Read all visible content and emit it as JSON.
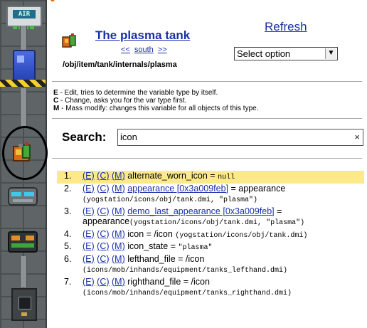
{
  "header": {
    "title": "The plasma tank",
    "nav_prev": "<<",
    "nav_location": "south",
    "nav_next": ">>",
    "type_path": "/obj/item/tank/internals/plasma",
    "refresh_label": "Refresh",
    "select_value": "Select option"
  },
  "sidebar": {
    "air_alarm_label": "AIR"
  },
  "help": [
    {
      "key": "E",
      "text": " - Edit, tries to determine the variable type by itself."
    },
    {
      "key": "C",
      "text": " - Change, asks you for the var type first."
    },
    {
      "key": "M",
      "text": " - Mass modify: changes this variable for all objects of this type."
    }
  ],
  "search": {
    "label": "Search:",
    "value": "icon",
    "clear_glyph": "×"
  },
  "vars": [
    {
      "num": "1.",
      "e": "(E)",
      "c": "(C)",
      "m": "(M)",
      "name": "alternate_worn_icon",
      "sep": " = ",
      "value": "null",
      "highlight": true
    },
    {
      "num": "2.",
      "e": "(E)",
      "c": "(C)",
      "m": "(M)",
      "name_link": "appearance [0x3a009feb]",
      "sep": " = ",
      "value": "appearance",
      "detail": "(yogstation/icons/obj/tank.dmi, \"plasma\")"
    },
    {
      "num": "3.",
      "e": "(E)",
      "c": "(C)",
      "m": "(M)",
      "name_link": "demo_last_appearance [0x3a009feb]",
      "sep": " = ",
      "value": "appearance",
      "detail": "(yogstation/icons/obj/tank.dmi, \"plasma\")"
    },
    {
      "num": "4.",
      "e": "(E)",
      "c": "(C)",
      "m": "(M)",
      "name": "icon",
      "sep": " = ",
      "value": "/icon",
      "detail": "(yogstation/icons/obj/tank.dmi)"
    },
    {
      "num": "5.",
      "e": "(E)",
      "c": "(C)",
      "m": "(M)",
      "name": "icon_state",
      "sep": " = ",
      "value": "\"plasma\""
    },
    {
      "num": "6.",
      "e": "(E)",
      "c": "(C)",
      "m": "(M)",
      "name": "lefthand_file",
      "sep": " = ",
      "value": "/icon",
      "detail": "(icons/mob/inhands/equipment/tanks_lefthand.dmi)"
    },
    {
      "num": "7.",
      "e": "(E)",
      "c": "(C)",
      "m": "(M)",
      "name": "righthand_file",
      "sep": " = ",
      "value": "/icon",
      "detail": "(icons/mob/inhands/equipment/tanks_righthand.dmi)"
    }
  ],
  "colors": {
    "link": "#1a2fa8",
    "highlight": "#fbe98a"
  }
}
